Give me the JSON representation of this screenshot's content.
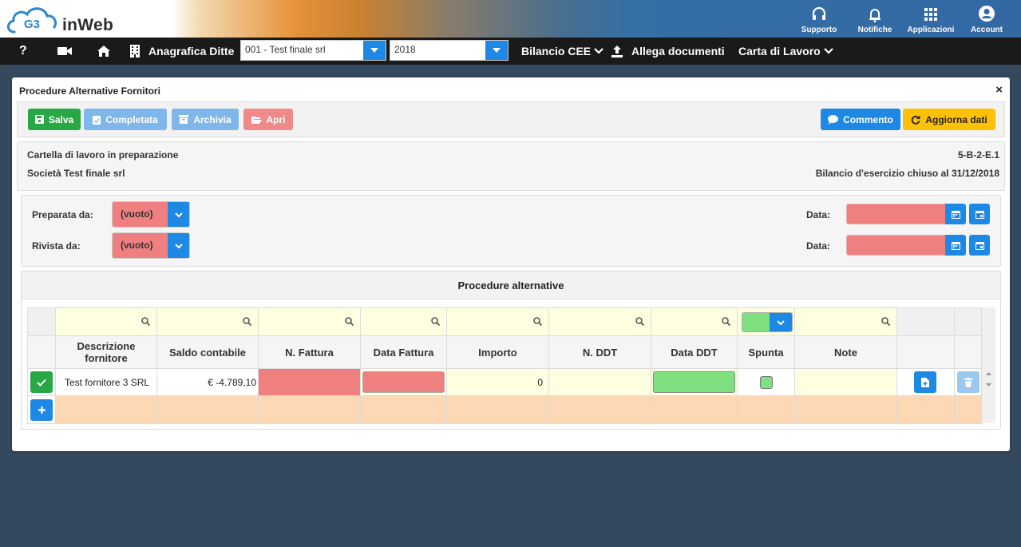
{
  "header": {
    "brand": "inWeb",
    "logo_text": "G3",
    "icons": [
      {
        "label": "Supporto",
        "icon": "headset-icon"
      },
      {
        "label": "Notifiche",
        "icon": "bell-icon"
      },
      {
        "label": "Applicazioni",
        "icon": "grid-icon"
      },
      {
        "label": "Account",
        "icon": "user-icon"
      }
    ]
  },
  "nav": {
    "help": "?",
    "anagrafica_label": "Anagrafica Ditte",
    "company_select": "001 - Test finale srl",
    "year_select": "2018",
    "bilancio_label": "Bilancio CEE",
    "allega_label": "Allega documenti",
    "carta_label": "Carta di Lavoro"
  },
  "modal": {
    "title": "Procedure Alternative Fornitori",
    "close": "×"
  },
  "toolbar": {
    "salva": "Salva",
    "completata": "Completata",
    "archivia": "Archivia",
    "apri": "Apri",
    "commento": "Commento",
    "aggiorna": "Aggiorna dati"
  },
  "info": {
    "status": "Cartella di lavoro in preparazione",
    "company": "Società Test finale srl",
    "code": "5-B-2-E.1",
    "bilancio": "Bilancio d'esercizio chiuso al 31/12/2018"
  },
  "prep": {
    "preparata_label": "Preparata da:",
    "preparata_value": "(vuoto)",
    "rivista_label": "Rivista da:",
    "rivista_value": "(vuoto)",
    "data_label": "Data:"
  },
  "procedure": {
    "title": "Procedure alternative",
    "columns": [
      "Descrizione fornitore",
      "Saldo contabile",
      "N. Fattura",
      "Data Fattura",
      "Importo",
      "N. DDT",
      "Data DDT",
      "Spunta",
      "Note"
    ],
    "rows": [
      {
        "descrizione": "Test fornitore 3 SRL",
        "saldo": "€ -4.789,10",
        "importo": "0"
      }
    ]
  },
  "colors": {
    "primary": "#1e88e5",
    "success": "#28a745",
    "danger_light": "#f08080",
    "warning": "#ffc107",
    "filter_bg": "#fefee0",
    "newrow_bg": "#fdd8b5"
  }
}
